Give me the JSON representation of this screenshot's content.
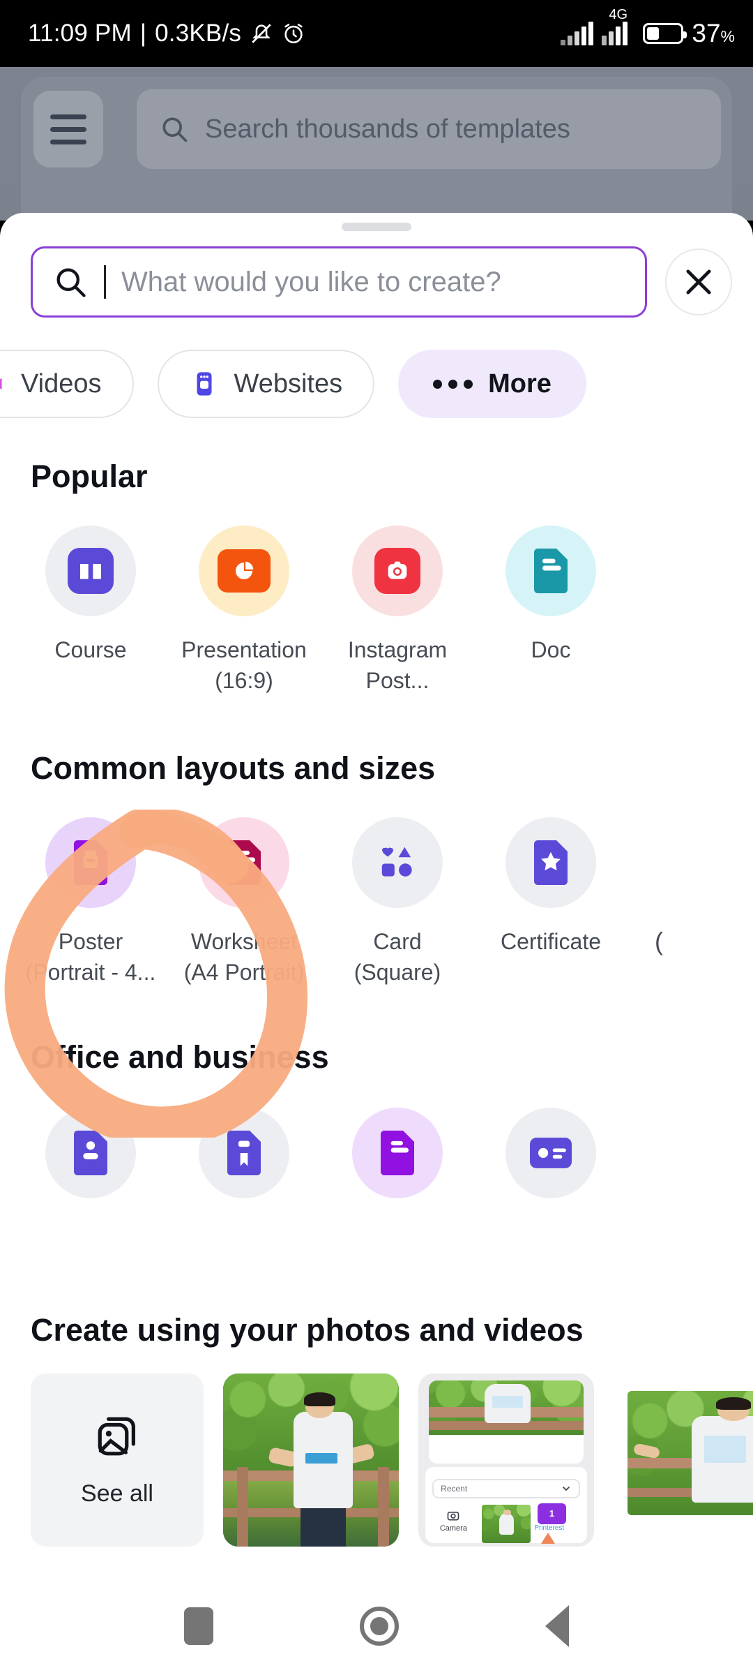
{
  "status_bar": {
    "time": "11:09 PM",
    "separator": "|",
    "network_speed": "0.3KB/s",
    "icons": [
      "mute-icon",
      "alarm-icon",
      "signal-icon",
      "signal-4g-icon",
      "battery-icon"
    ],
    "network_type": "4G",
    "battery_percent": "37",
    "battery_percent_symbol": "%",
    "battery_level": 37
  },
  "background_app": {
    "menu_icon": "hamburger-menu-icon",
    "search_placeholder": "Search thousands of templates",
    "search_icon": "search-icon"
  },
  "sheet": {
    "grabber": "drag-handle",
    "search": {
      "icon": "search-icon",
      "value": "",
      "placeholder": "What would you like to create?"
    },
    "close_label": "✕",
    "chips": [
      {
        "label": "Videos",
        "icon": "video-icon",
        "icon_color": "#d44be0",
        "selected": false,
        "cut_off": true
      },
      {
        "label": "Websites",
        "icon": "website-icon",
        "icon_color": "#4f46e5",
        "selected": false,
        "cut_off": false
      },
      {
        "label": "More",
        "icon": "ellipsis-icon",
        "icon_color": "#11141a",
        "selected": true,
        "cut_off": false
      }
    ],
    "sections": [
      {
        "title": "Popular",
        "items": [
          {
            "label": "Course",
            "bubble": "#eceef1",
            "tile": "#5b4ad8",
            "icon": "book-icon"
          },
          {
            "label": "Presentation (16:9)",
            "bubble": "#fdecc4",
            "tile": "#f4550e",
            "icon": "pie-chart-icon"
          },
          {
            "label": "Instagram Post...",
            "bubble": "#fadfe0",
            "tile": "#ef3340",
            "icon": "instagram-icon"
          },
          {
            "label": "Doc",
            "bubble": "#d6f4f7",
            "tile": "#1a98a8",
            "icon": "document-icon",
            "flat": true
          }
        ]
      },
      {
        "title": "Common layouts and sizes",
        "items": [
          {
            "label": "Poster (Portrait - 4...",
            "bubble": "#e8d3fb",
            "tile": "#9111e0",
            "icon": "poster-icon",
            "flat": true
          },
          {
            "label": "Worksheet (A4 Portrait)",
            "bubble": "#fbd9e7",
            "tile": "#ad0a4e",
            "icon": "worksheet-icon",
            "flat": true
          },
          {
            "label": "Card (Square)",
            "bubble": "#eceef1",
            "tile": "#5b4ad8",
            "icon": "shapes-icon",
            "flat": true
          },
          {
            "label": "Certificate",
            "bubble": "#eceef1",
            "tile": "#5b4ad8",
            "icon": "certificate-icon",
            "flat": true
          },
          {
            "label": "(",
            "bubble": "",
            "tile": "",
            "icon": "cut-off-item",
            "partial": true
          }
        ]
      },
      {
        "title": "Office and business",
        "items": [
          {
            "label": "",
            "bubble": "#eceef1",
            "tile": "#5b4ad8",
            "icon": "resume-icon",
            "flat": true
          },
          {
            "label": "",
            "bubble": "#eceef1",
            "tile": "#5b4ad8",
            "icon": "bookmark-doc-icon",
            "flat": true
          },
          {
            "label": "",
            "bubble": "#efdcfd",
            "tile": "#9111e0",
            "icon": "letter-icon",
            "flat": true
          },
          {
            "label": "",
            "bubble": "#eceef1",
            "tile": "#5b4ad8",
            "icon": "id-card-icon",
            "flat": true
          }
        ]
      }
    ],
    "annotation": {
      "shape": "hand-drawn-circle",
      "color": "#f9ab80",
      "target": "Poster (Portrait - 4..."
    }
  },
  "photos_section": {
    "title": "Create using your photos and videos",
    "see_all": {
      "label": "See all",
      "icon": "gallery-icon"
    },
    "thumbnails": [
      {
        "name": "photo-person-on-bridge"
      },
      {
        "name": "photo-app-screenshot"
      },
      {
        "name": "photo-person-on-bridge-2"
      }
    ],
    "screenshot_thumb": {
      "dropdown_label": "Recent",
      "camera_label": "Camera",
      "badge": "1",
      "watermark": "Printerest"
    }
  },
  "nav_bar": {
    "recents": "recents-button",
    "home": "home-button",
    "back": "back-button"
  }
}
